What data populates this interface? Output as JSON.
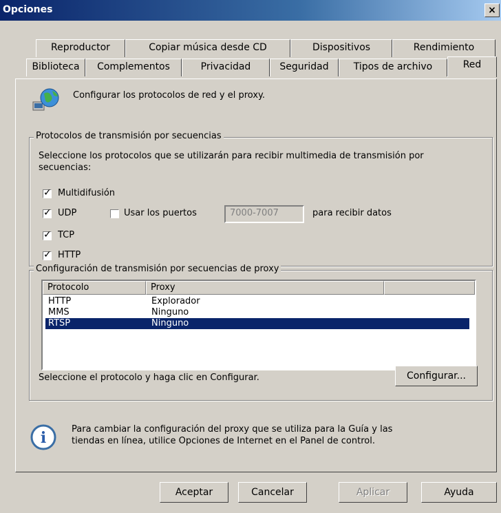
{
  "window": {
    "title": "Opciones",
    "close_glyph": "×"
  },
  "tabs": {
    "row_back": [
      "Reproductor",
      "Copiar música desde CD",
      "Dispositivos",
      "Rendimiento"
    ],
    "row_front": [
      "Biblioteca",
      "Complementos",
      "Privacidad",
      "Seguridad",
      "Tipos de archivo",
      "Red"
    ]
  },
  "header": {
    "text": "Configurar los protocolos de red y el proxy.",
    "icon": "network-globe-icon"
  },
  "streaming": {
    "legend": "Protocolos de transmisión por secuencias",
    "description": "Seleccione los protocolos que se utilizarán para recibir multimedia de transmisión por secuencias:",
    "multidifusion": "Multidifusión",
    "udp": "UDP",
    "use_ports": "Usar los puertos",
    "ports_value": "7000-7007",
    "ports_suffix": "para recibir datos",
    "tcp": "TCP",
    "http": "HTTP",
    "check_glyph": "✓"
  },
  "proxy": {
    "legend": "Configuración de transmisión por secuencias de proxy",
    "col_protocol": "Protocolo",
    "col_proxy": "Proxy",
    "rows": [
      {
        "protocol": "HTTP",
        "proxy": "Explorador"
      },
      {
        "protocol": "MMS",
        "proxy": "Ninguno"
      },
      {
        "protocol": "RTSP",
        "proxy": "Ninguno"
      }
    ],
    "hint": "Seleccione el protocolo y haga clic en Configurar.",
    "configure_button": "Configurar..."
  },
  "info": {
    "text": "Para cambiar la configuración del proxy que se utiliza para la Guía y las tiendas en línea, utilice Opciones de Internet en el Panel de control.",
    "icon": "info-icon",
    "icon_glyph": "i"
  },
  "buttons": {
    "ok": "Aceptar",
    "cancel": "Cancelar",
    "apply": "Aplicar",
    "help": "Ayuda"
  }
}
